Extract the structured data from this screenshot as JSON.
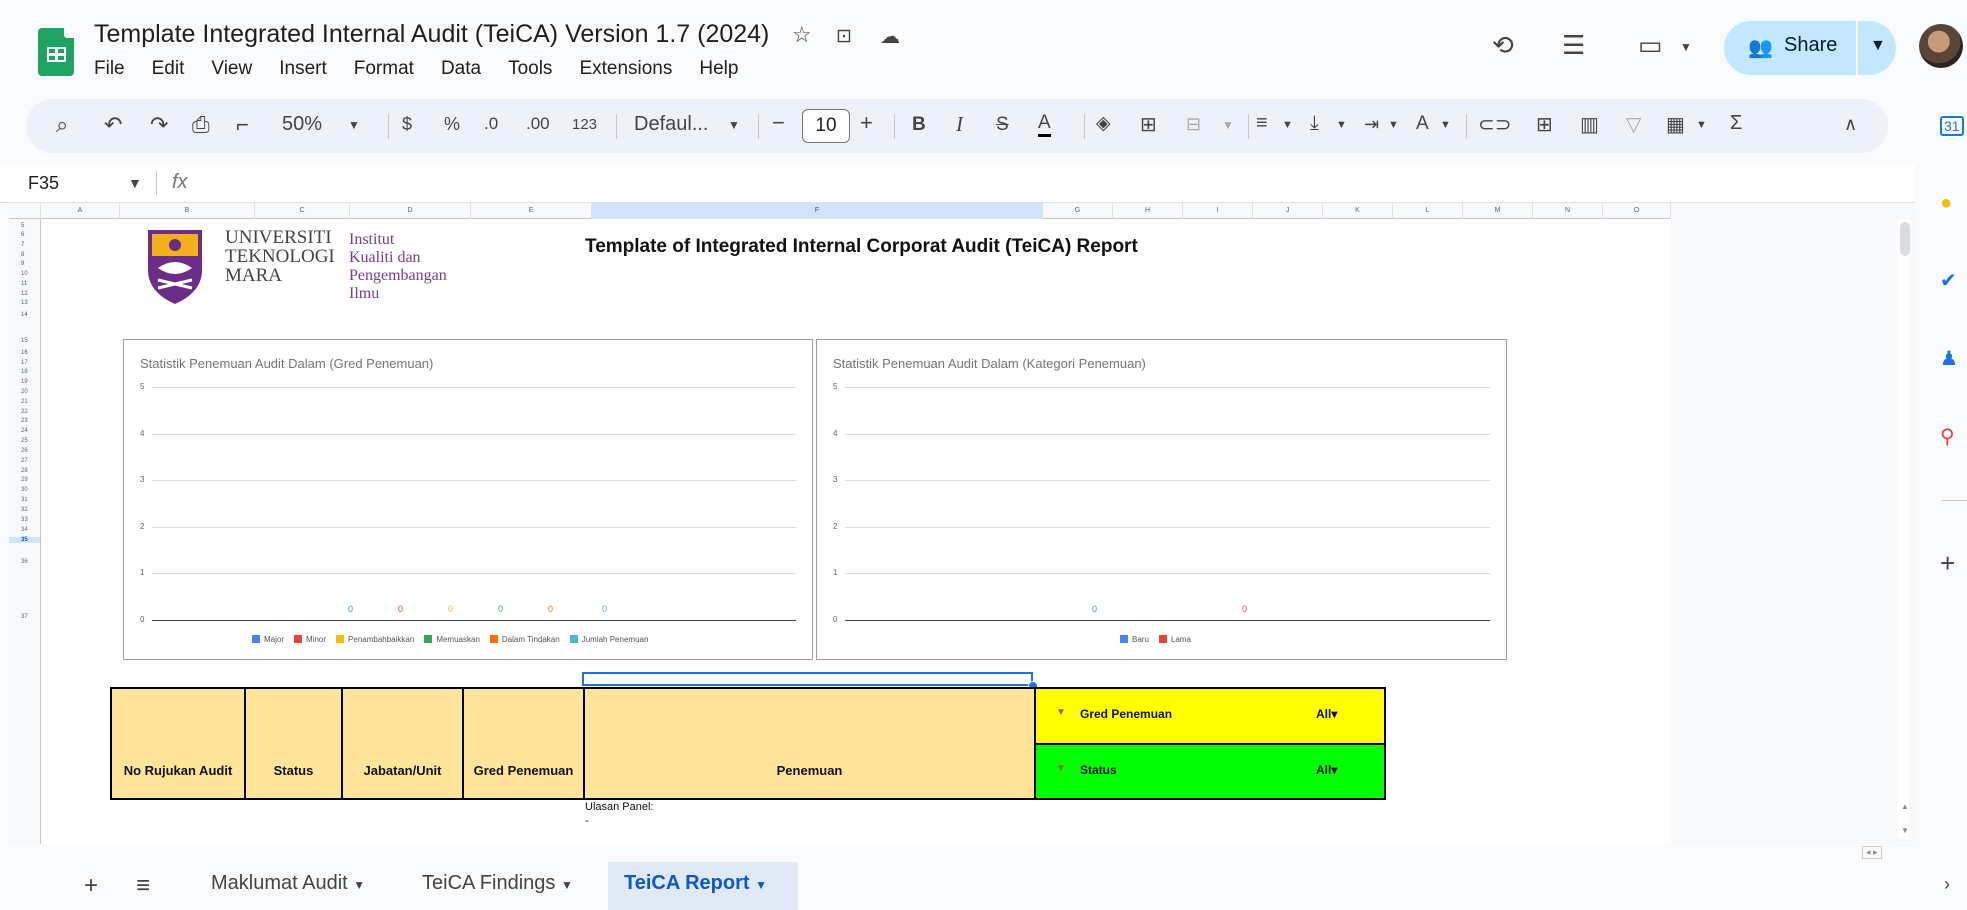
{
  "doc": {
    "title": "Template Integrated Internal Audit (TeiCA) Version 1.7 (2024)",
    "menu": [
      "File",
      "Edit",
      "View",
      "Insert",
      "Format",
      "Data",
      "Tools",
      "Extensions",
      "Help"
    ],
    "share_label": "Share"
  },
  "toolbar": {
    "zoom": "50%",
    "currency": "$",
    "percent": "%",
    "dec_decrease": ".0",
    "dec_increase": ".00",
    "number_format": "123",
    "font": "Defaul...",
    "font_size": "10"
  },
  "formula_bar": {
    "name_box": "F35",
    "fx": "fx",
    "value": ""
  },
  "columns": [
    "A",
    "B",
    "C",
    "D",
    "E",
    "F",
    "G",
    "H",
    "I",
    "J",
    "K",
    "L",
    "M",
    "N",
    "O"
  ],
  "rows": [
    "5",
    "6",
    "7",
    "8",
    "9",
    "10",
    "11",
    "12",
    "13",
    "14",
    "15",
    "16",
    "17",
    "18",
    "19",
    "20",
    "21",
    "22",
    "23",
    "24",
    "25",
    "26",
    "27",
    "28",
    "29",
    "30",
    "31",
    "32",
    "33",
    "34",
    "35",
    "36",
    "37"
  ],
  "header": {
    "uitm_name": [
      "UNIVERSITI",
      "TEKNOLOGI",
      "MARA"
    ],
    "institute": [
      "Institut",
      "Kualiti dan",
      "Pengembangan",
      "Ilmu"
    ],
    "report_title": "Template of Integrated Internal Corporat Audit (TeiCA) Report"
  },
  "chart_data": [
    {
      "type": "bar",
      "title": "Statistik Penemuan Audit Dalam (Gred Penemuan)",
      "ylim": [
        0,
        5
      ],
      "yticks": [
        "0",
        "1",
        "2",
        "3",
        "4",
        "5"
      ],
      "grid": true,
      "legend_position": "bottom",
      "series": [
        {
          "name": "Major",
          "values": [
            0
          ],
          "label": "0",
          "color": "#4285f4"
        },
        {
          "name": "Minor",
          "values": [
            0
          ],
          "label": "0",
          "color": "#ea4335"
        },
        {
          "name": "Penambahbaikkan",
          "values": [
            0
          ],
          "label": "0",
          "color": "#fbbc04"
        },
        {
          "name": "Memuaskan",
          "values": [
            0
          ],
          "label": "0",
          "color": "#34a853"
        },
        {
          "name": "Dalam Tindakan",
          "values": [
            0
          ],
          "label": "0",
          "color": "#ff6d01"
        },
        {
          "name": "Jumlah Penemuan",
          "values": [
            0
          ],
          "label": "0",
          "color": "#46bdc6"
        }
      ]
    },
    {
      "type": "bar",
      "title": "Statistik Penemuan Audit Dalam (Kategori Penemuan)",
      "ylim": [
        0,
        5
      ],
      "yticks": [
        "0",
        "1",
        "2",
        "3",
        "4",
        "5"
      ],
      "grid": true,
      "legend_position": "bottom",
      "series": [
        {
          "name": "Baru",
          "values": [
            0
          ],
          "label": "0",
          "color": "#4285f4"
        },
        {
          "name": "Lama",
          "values": [
            0
          ],
          "label": "0",
          "color": "#ea4335"
        }
      ]
    }
  ],
  "table": {
    "headers": [
      "No Rujukan Audit",
      "Status",
      "Jabatan/Unit",
      "Gred Penemuan",
      "Penemuan"
    ],
    "filters": [
      {
        "label": "Gred Penemuan",
        "value": "All▾",
        "color": "#ffff00"
      },
      {
        "label": "Status",
        "value": "All▾",
        "color": "#00ff00"
      }
    ],
    "header_color": "#fee599",
    "ulasan": "Ulasan Panel:",
    "ulasan_value": "-"
  },
  "tabs": [
    {
      "label": "Maklumat Audit"
    },
    {
      "label": "TeiCA Findings"
    },
    {
      "label": "TeiCA Report",
      "active": true
    }
  ],
  "colors": {
    "accent": "#1a73e8",
    "share_bg": "#c2e7ff",
    "sheets_green": "#1ea362"
  }
}
